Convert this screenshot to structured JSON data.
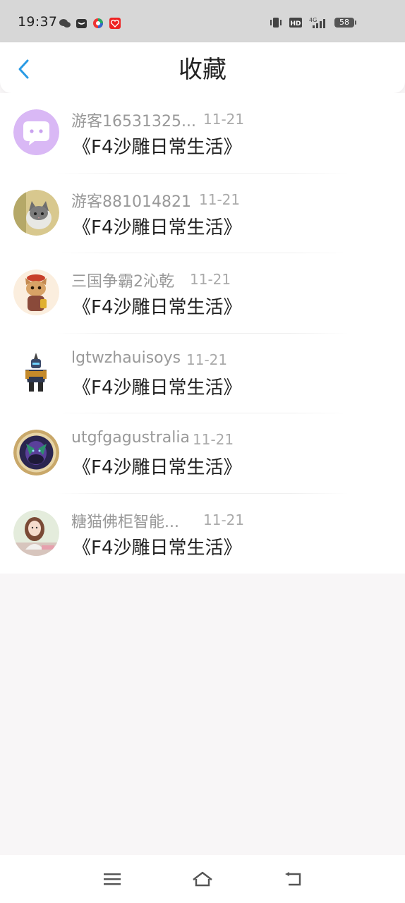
{
  "status_bar": {
    "time": "19:37",
    "battery": "58",
    "network": "4G",
    "hd_label": "HD"
  },
  "header": {
    "title": "收藏",
    "back_icon": "chevron-left-icon"
  },
  "favorites": [
    {
      "user": "游客16531325...",
      "date": "11-21",
      "title": "《F4沙雕日常生活》",
      "avatar": "default-chat-avatar"
    },
    {
      "user": "游客881014821",
      "date": "11-21",
      "title": "《F4沙雕日常生活》",
      "avatar": "cat-photo-avatar"
    },
    {
      "user": "三国争霸2沁乾",
      "date": "11-21",
      "title": "《F4沙雕日常生活》",
      "avatar": "cartoon-cat-avatar"
    },
    {
      "user": "lgtwzhauisoys",
      "date": "11-21",
      "title": "《F4沙雕日常生活》",
      "avatar": "armored-figure-avatar"
    },
    {
      "user": "utgfgagustralia",
      "date": "11-21",
      "title": "《F4沙雕日常生活》",
      "avatar": "game-emblem-avatar"
    },
    {
      "user": "糖猫佛柜智能...",
      "date": "11-21",
      "title": "《F4沙雕日常生活》",
      "avatar": "girl-photo-avatar"
    }
  ],
  "nav_bar": {
    "icons": [
      "menu-icon",
      "home-icon",
      "back-icon"
    ]
  },
  "colors": {
    "accent": "#2a9be5",
    "avatar_default": "#d9b8f5"
  }
}
